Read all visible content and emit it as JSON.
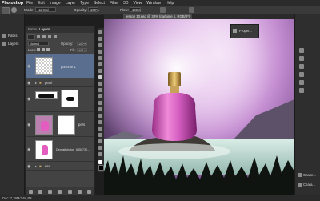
{
  "app": "Photoshop",
  "menu": [
    "File",
    "Edit",
    "Image",
    "Layer",
    "Type",
    "Select",
    "Filter",
    "3D",
    "View",
    "Window",
    "Help"
  ],
  "options_bar": {
    "mode_label": "Mode:",
    "mode_value": "Normal",
    "opacity_label": "Opacity:",
    "opacity_value": "100%",
    "flow_label": "Flow:",
    "flow_value": "100%"
  },
  "left_panel": {
    "items": [
      "Paths",
      "Layers"
    ]
  },
  "layers_panel": {
    "tabs": [
      "Paths",
      "Layers"
    ],
    "blend_mode": "Normal",
    "opacity_label": "Opacity:",
    "opacity_value": "100%",
    "lock_label": "Lock:",
    "fill_label": "Fill:",
    "fill_value": "100%",
    "layers": [
      {
        "name": "parfume 1"
      },
      {
        "name": "pearl"
      },
      {
        "name": ""
      },
      {
        "name": "pers"
      },
      {
        "name": "Depositphotos_6850732..."
      },
      {
        "name": "sea"
      }
    ]
  },
  "doc_tab": "lesson 10.psd @ 33% (parfume 1, RGB/8*)",
  "brush_panel": {
    "items": [
      "Brush",
      "Brush..."
    ]
  },
  "properties_panel": {
    "label": "Proper..."
  },
  "right_panel": {
    "items": [
      "Chann...",
      "Chara..."
    ]
  },
  "status": "Doc: 7,39M/248,4M",
  "colors": {
    "canvas_sky_top": "#f7eef9",
    "bottle": "#d65fc2",
    "cap": "#c79a3a"
  }
}
